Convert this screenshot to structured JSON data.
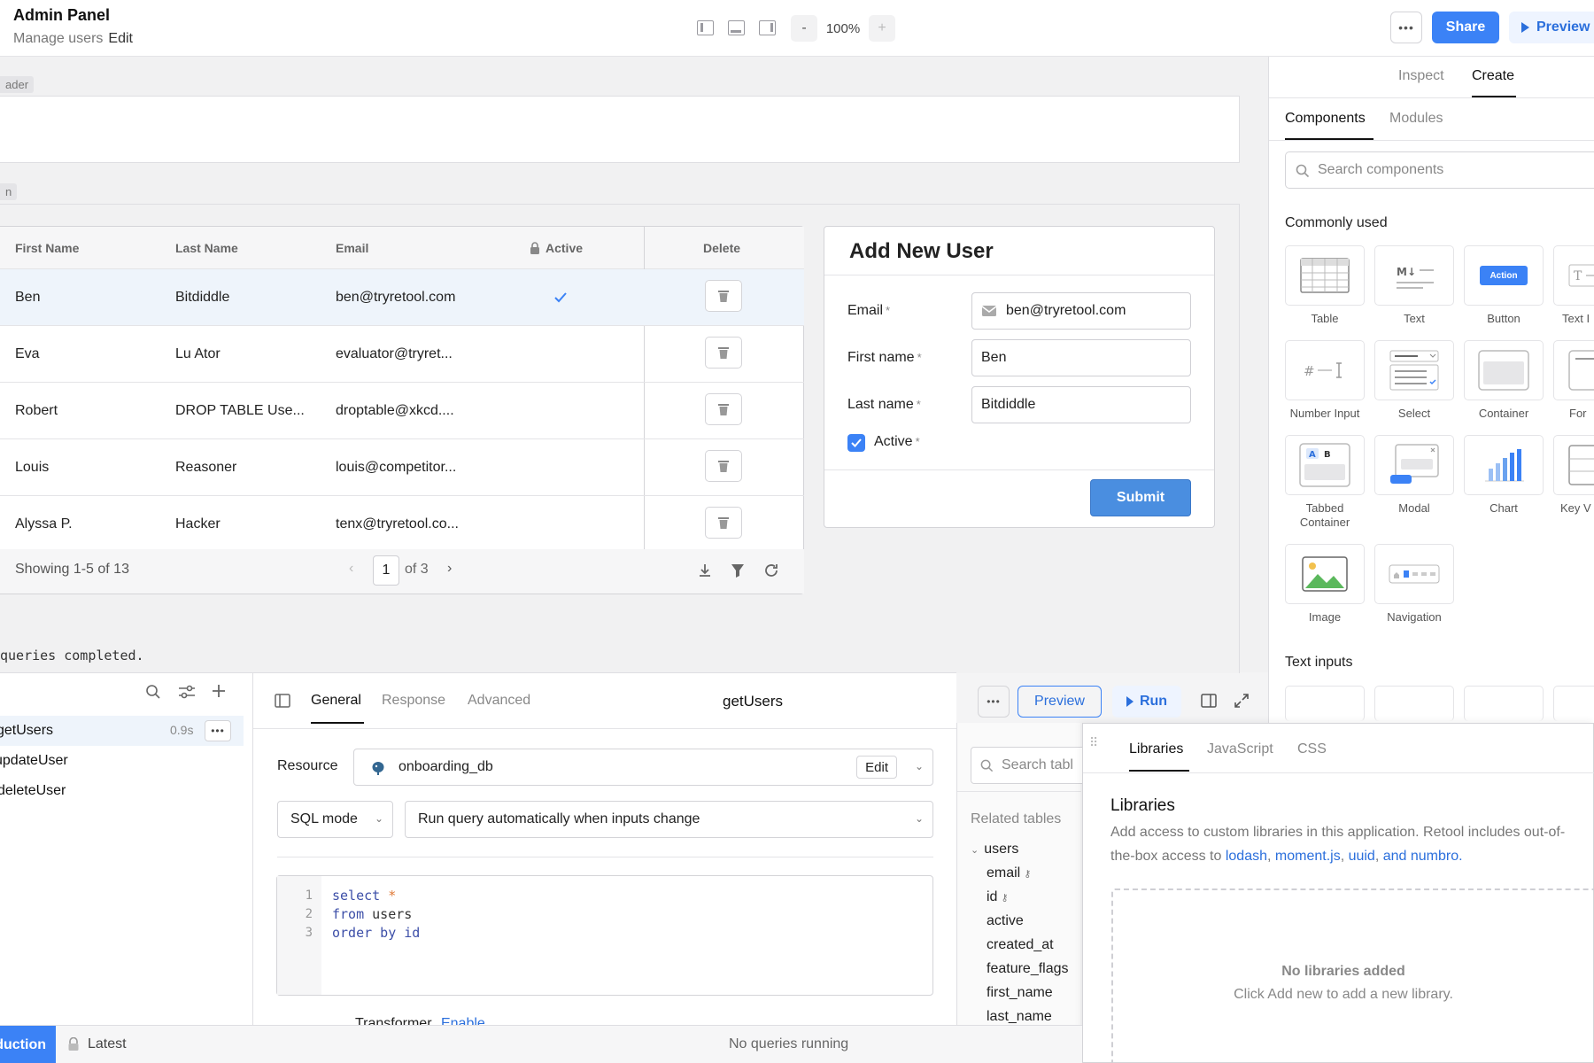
{
  "topbar": {
    "app_title": "Admin Panel",
    "page_name": "Manage users",
    "edit_label": "Edit",
    "zoom_minus": "-",
    "zoom_value": "100%",
    "zoom_plus": "+",
    "more": "•••",
    "share": "Share",
    "preview": "Preview"
  },
  "canvas": {
    "header_tag": "ader",
    "main_tag": "n",
    "queries_note": "queries completed."
  },
  "table": {
    "columns": [
      "First Name",
      "Last Name",
      "Email",
      "Active",
      "Delete"
    ],
    "rows": [
      {
        "first": "Ben",
        "last": "Bitdiddle",
        "email": "ben@tryretool.com",
        "active": true
      },
      {
        "first": "Eva",
        "last": "Lu Ator",
        "email": "evaluator@tryret...",
        "active": false
      },
      {
        "first": "Robert",
        "last": "DROP TABLE Use...",
        "email": "droptable@xkcd....",
        "active": false
      },
      {
        "first": "Louis",
        "last": "Reasoner",
        "email": "louis@competitor...",
        "active": false
      },
      {
        "first": "Alyssa P.",
        "last": "Hacker",
        "email": "tenx@tryretool.co...",
        "active": false
      }
    ],
    "footer": {
      "showing": "Showing 1-5 of 13",
      "page": "1",
      "of_pages": "of 3"
    }
  },
  "form": {
    "title": "Add New User",
    "email_label": "Email",
    "email_value": "ben@tryretool.com",
    "first_label": "First name",
    "first_value": "Ben",
    "last_label": "Last name",
    "last_value": "Bitdiddle",
    "active_label": "Active",
    "required_mark": "*",
    "submit": "Submit"
  },
  "right_panel": {
    "tabs": [
      "Inspect",
      "Create"
    ],
    "subtabs": [
      "Components",
      "Modules"
    ],
    "search_placeholder": "Search components",
    "commonly_used": "Commonly used",
    "components": [
      {
        "label": "Table",
        "icon": "table-icon"
      },
      {
        "label": "Text",
        "icon": "text-markdown-icon"
      },
      {
        "label": "Button",
        "icon": "button-icon"
      },
      {
        "label": "Text I",
        "icon": "text-input-icon"
      },
      {
        "label": "Number Input",
        "icon": "number-input-icon"
      },
      {
        "label": "Select",
        "icon": "select-icon"
      },
      {
        "label": "Container",
        "icon": "container-icon"
      },
      {
        "label": "For",
        "icon": "form-icon"
      },
      {
        "label": "Tabbed Container",
        "icon": "tabbed-container-icon"
      },
      {
        "label": "Modal",
        "icon": "modal-icon"
      },
      {
        "label": "Chart",
        "icon": "chart-icon"
      },
      {
        "label": "Key V",
        "icon": "key-value-icon"
      },
      {
        "label": "Image",
        "icon": "image-icon"
      },
      {
        "label": "Navigation",
        "icon": "navigation-icon"
      }
    ],
    "button_tile_text": "Action",
    "text_inputs": "Text inputs"
  },
  "queries": {
    "items": [
      {
        "name": "getUsers",
        "time": "0.9s"
      },
      {
        "name": "updateUser"
      },
      {
        "name": "deleteUser"
      }
    ],
    "tabs": [
      "General",
      "Response",
      "Advanced"
    ],
    "active_query": "getUsers",
    "preview": "Preview",
    "run": "Run",
    "resource_label": "Resource",
    "resource_value": "onboarding_db",
    "resource_edit": "Edit",
    "mode": "SQL mode",
    "trigger": "Run query automatically when inputs change",
    "code_lines": [
      "select *",
      "from users",
      "order by id"
    ],
    "transformer_label": "Transformer",
    "transformer_action": "Enable"
  },
  "related": {
    "search_placeholder": "Search tabl",
    "heading": "Related tables",
    "table": "users",
    "fields": [
      "email",
      "id",
      "active",
      "created_at",
      "feature_flags",
      "first_name",
      "last_name"
    ]
  },
  "libraries": {
    "tabs": [
      "Libraries",
      "JavaScript",
      "CSS"
    ],
    "title": "Libraries",
    "desc_prefix": "Add access to custom libraries in this application. Retool includes out-of-",
    "desc_line2_prefix": "the-box access to ",
    "links": [
      "lodash",
      "moment.js",
      "uuid",
      "and numbro."
    ],
    "empty_title": "No libraries added",
    "empty_desc": "Click Add new to add a new library."
  },
  "status": {
    "env": "duction",
    "branch": "Latest",
    "running": "No queries running"
  },
  "colors": {
    "accent": "#3b82f6",
    "link": "#2b6fdc"
  }
}
